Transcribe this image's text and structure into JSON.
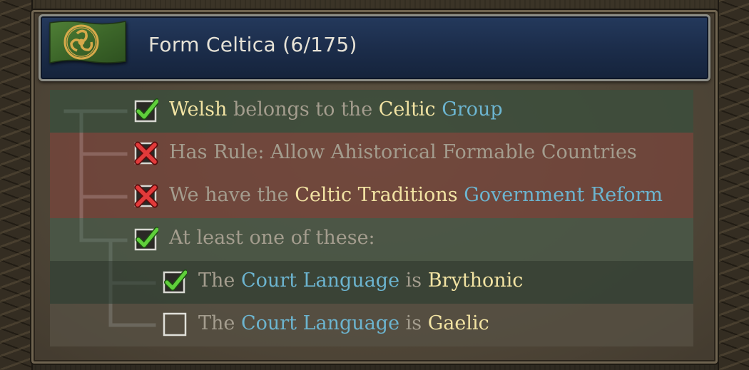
{
  "panel": {
    "title": "Form Celtica (6/175)",
    "flag_icon": "celtic-triskele-flag-icon",
    "colors": {
      "title_bar": "#1b2c49",
      "flag_green": "#3f6a2c",
      "emblem_gold": "#d6a94a",
      "highlight_yellow": "#f2e3a3",
      "highlight_blue": "#6cb4cf",
      "muted_text": "#a49d8e"
    }
  },
  "conditions": [
    {
      "status": "met",
      "parts": [
        "Welsh",
        " belongs to the ",
        "Celtic",
        " ",
        "Group"
      ]
    },
    {
      "status": "unmet",
      "parts": [
        "Has Rule: Allow Ahistorical Formable Countries"
      ]
    },
    {
      "status": "unmet",
      "parts": [
        "We have the ",
        "Celtic Traditions",
        " ",
        "Government Reform"
      ]
    },
    {
      "status": "met",
      "parts": [
        "At least one of these:"
      ]
    },
    {
      "status": "met",
      "parts": [
        "The ",
        "Court Language",
        " is ",
        "Brythonic"
      ]
    },
    {
      "status": "empty",
      "parts": [
        "The ",
        "Court Language",
        " is ",
        "Gaelic"
      ]
    }
  ]
}
